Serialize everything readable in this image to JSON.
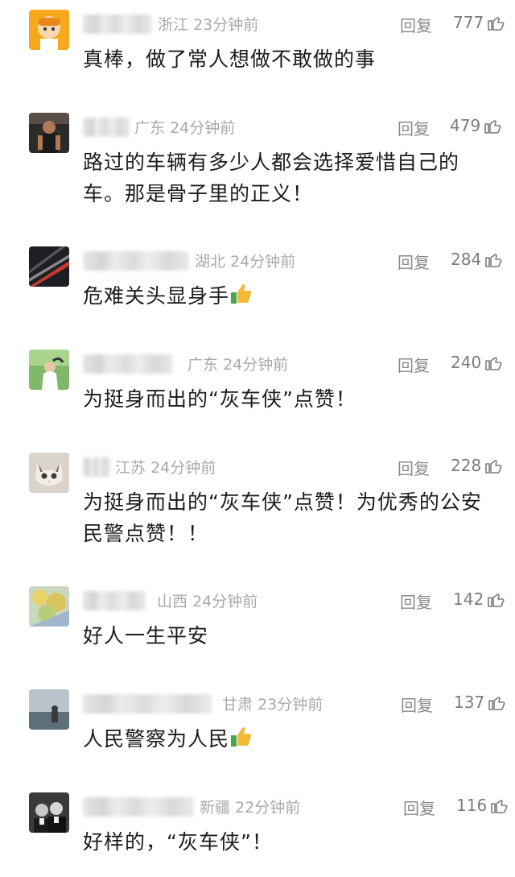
{
  "comments": [
    {
      "location": "浙江",
      "time": "23分钟前",
      "reply": "回复",
      "likes": "777",
      "text": "真棒，做了常人想做不敢做的事",
      "emoji": false
    },
    {
      "location": "广东",
      "time": "24分钟前",
      "reply": "回复",
      "likes": "479",
      "text": "路过的车辆有多少人都会选择爱惜自己的车。那是骨子里的正义！",
      "emoji": false
    },
    {
      "location": "湖北",
      "time": "24分钟前",
      "reply": "回复",
      "likes": "284",
      "text": "危难关头显身手",
      "emoji": true
    },
    {
      "location": "广东",
      "time": "24分钟前",
      "reply": "回复",
      "likes": "240",
      "text": "为挺身而出的“灰车侠”点赞！",
      "emoji": false
    },
    {
      "location": "江苏",
      "time": "24分钟前",
      "reply": "回复",
      "likes": "228",
      "text": "为挺身而出的“灰车侠”点赞！为优秀的公安民警点赞！！",
      "emoji": false
    },
    {
      "location": "山西",
      "time": "24分钟前",
      "reply": "回复",
      "likes": "142",
      "text": "好人一生平安",
      "emoji": false
    },
    {
      "location": "甘肃",
      "time": "23分钟前",
      "reply": "回复",
      "likes": "137",
      "text": "人民警察为人民",
      "emoji": true
    },
    {
      "location": "新疆",
      "time": "22分钟前",
      "reply": "回复",
      "likes": "116",
      "text": "好样的，“灰车侠”！",
      "emoji": false
    }
  ],
  "icons": {
    "like": "thumbs-up-outline-icon",
    "emoji": "thumbs-up-emoji-icon"
  },
  "colors": {
    "meta_text": "#a9a9a9",
    "body_text": "#1c1c1c",
    "emoji_thumb": "#f5b93a",
    "emoji_cuff": "#4aa64a"
  }
}
